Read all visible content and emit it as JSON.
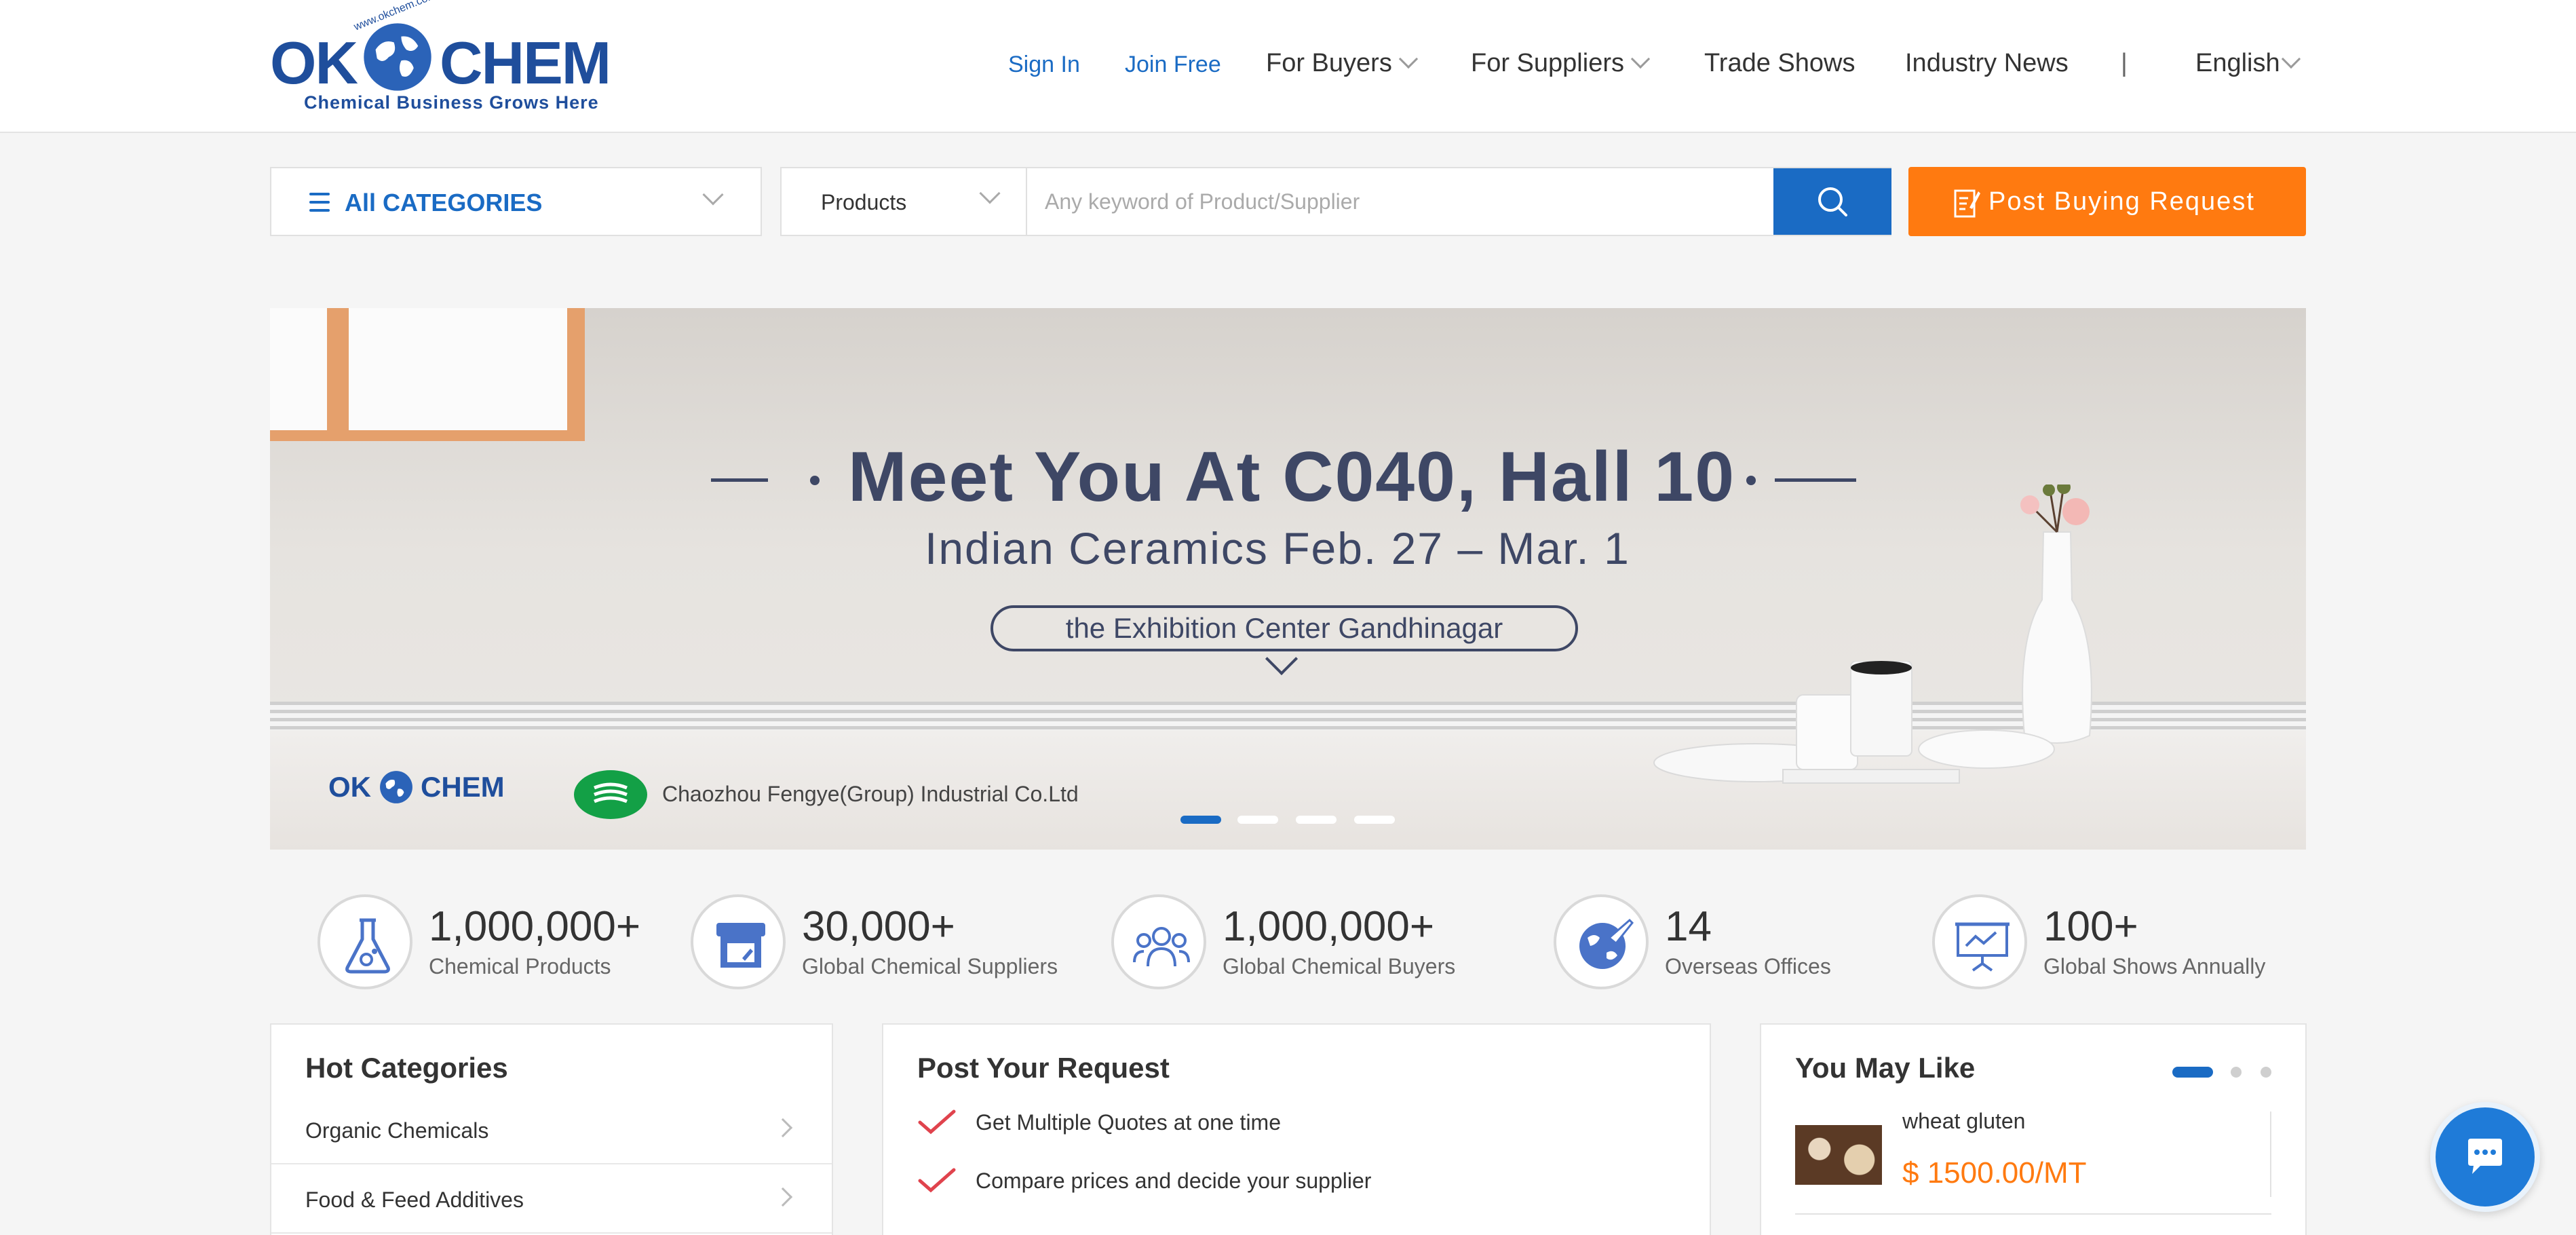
{
  "header": {
    "logo_left": "OK",
    "logo_right": "CHEM",
    "logo_url": "www.okchem.com",
    "logo_tagline": "Chemical Business Grows Here",
    "nav": {
      "sign_in": "Sign In",
      "join_free": "Join Free",
      "for_buyers": "For Buyers",
      "for_suppliers": "For Suppliers",
      "trade_shows": "Trade Shows",
      "industry_news": "Industry News",
      "separator": "|",
      "language": "English"
    }
  },
  "search": {
    "all_categories": "All CATEGORIES",
    "type_selected": "Products",
    "placeholder": "Any keyword of Product/Supplier",
    "value": "",
    "post_buying_request": "Post Buying Request"
  },
  "banner": {
    "title": "Meet You At C040, Hall 10",
    "subtitle": "Indian Ceramics   Feb. 27 – Mar. 1",
    "venue": "the Exhibition Center Gandhinagar",
    "logo_left": "OK",
    "logo_right": "CHEM",
    "company": "Chaozhou Fengye(Group) Industrial Co.Ltd",
    "slide_count": 4,
    "active_slide": 1
  },
  "stats": [
    {
      "value": "1,000,000+",
      "label": "Chemical Products",
      "icon": "flask-icon"
    },
    {
      "value": "30,000+",
      "label": "Global Chemical Suppliers",
      "icon": "store-icon"
    },
    {
      "value": "1,000,000+",
      "label": "Global Chemical Buyers",
      "icon": "buyers-icon"
    },
    {
      "value": "14",
      "label": "Overseas Offices",
      "icon": "plane-globe-icon"
    },
    {
      "value": "100+",
      "label": "Global Shows Annually",
      "icon": "presentation-icon"
    }
  ],
  "hot_categories": {
    "title": "Hot Categories",
    "items": [
      "Organic Chemicals",
      "Food & Feed Additives"
    ]
  },
  "post_request": {
    "title": "Post Your Request",
    "items": [
      "Get Multiple Quotes at one time",
      "Compare prices and decide your supplier"
    ]
  },
  "you_may_like": {
    "title": "You May Like",
    "product_name": "wheat gluten",
    "price": "$ 1500.00/MT",
    "page_count": 3,
    "active_page": 1
  },
  "colors": {
    "brand_blue": "#1a6bc4",
    "accent_orange": "#ff7a10",
    "banner_text": "#3e4765"
  }
}
